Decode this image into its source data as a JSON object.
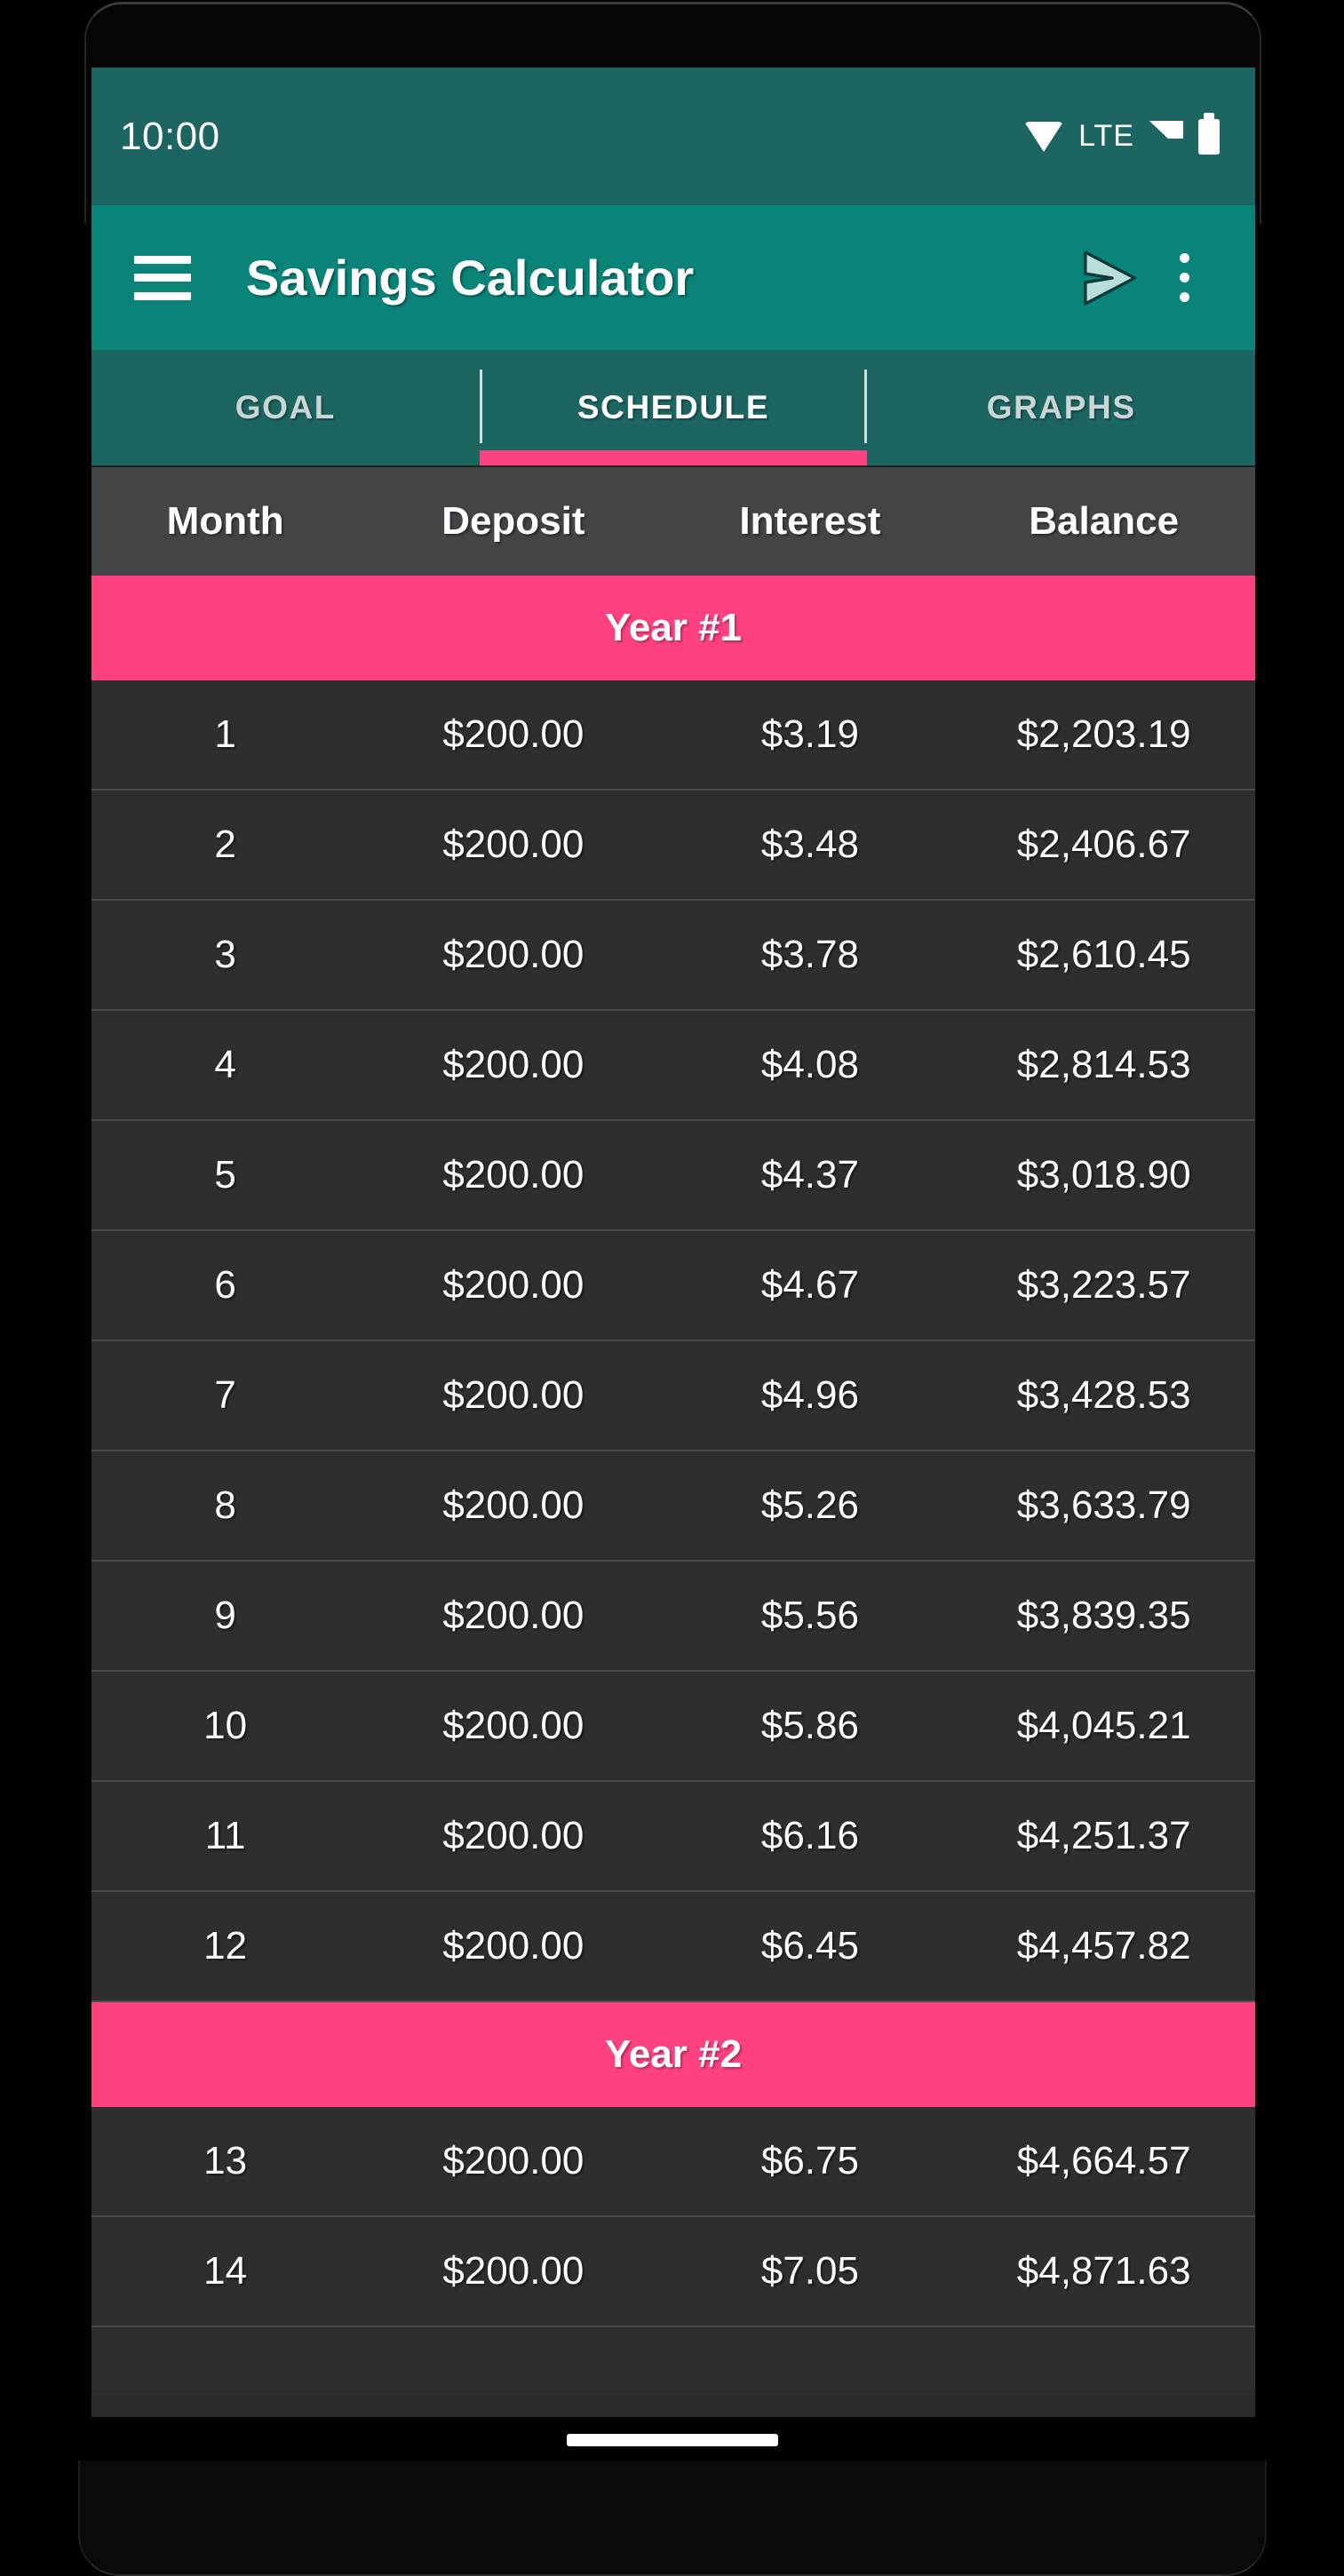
{
  "status_bar": {
    "time": "10:00",
    "network_label": "LTE",
    "icons": [
      "wifi-icon",
      "signal-icon",
      "battery-icon"
    ]
  },
  "app_bar": {
    "title": "Savings Calculator",
    "menu_icon": "hamburger-menu-icon",
    "send_icon": "send-icon",
    "overflow_icon": "overflow-menu-icon"
  },
  "tabs": [
    {
      "label": "GOAL",
      "active": false
    },
    {
      "label": "SCHEDULE",
      "active": true
    },
    {
      "label": "GRAPHS",
      "active": false
    }
  ],
  "colors": {
    "status_bar_teal": "#1d6561",
    "app_bar_teal": "#0a8378",
    "tab_bar_teal": "#1d6561",
    "accent_pink": "#ff4081",
    "table_header_gray": "#414548",
    "row_gray": "#2e2e2e",
    "row_divider": "#4c4c4c"
  },
  "table": {
    "columns": [
      "Month",
      "Deposit",
      "Interest",
      "Balance"
    ],
    "sections": [
      {
        "banner": "Year #1",
        "rows": [
          {
            "month": "1",
            "deposit": "$200.00",
            "interest": "$3.19",
            "balance": "$2,203.19"
          },
          {
            "month": "2",
            "deposit": "$200.00",
            "interest": "$3.48",
            "balance": "$2,406.67"
          },
          {
            "month": "3",
            "deposit": "$200.00",
            "interest": "$3.78",
            "balance": "$2,610.45"
          },
          {
            "month": "4",
            "deposit": "$200.00",
            "interest": "$4.08",
            "balance": "$2,814.53"
          },
          {
            "month": "5",
            "deposit": "$200.00",
            "interest": "$4.37",
            "balance": "$3,018.90"
          },
          {
            "month": "6",
            "deposit": "$200.00",
            "interest": "$4.67",
            "balance": "$3,223.57"
          },
          {
            "month": "7",
            "deposit": "$200.00",
            "interest": "$4.96",
            "balance": "$3,428.53"
          },
          {
            "month": "8",
            "deposit": "$200.00",
            "interest": "$5.26",
            "balance": "$3,633.79"
          },
          {
            "month": "9",
            "deposit": "$200.00",
            "interest": "$5.56",
            "balance": "$3,839.35"
          },
          {
            "month": "10",
            "deposit": "$200.00",
            "interest": "$5.86",
            "balance": "$4,045.21"
          },
          {
            "month": "11",
            "deposit": "$200.00",
            "interest": "$6.16",
            "balance": "$4,251.37"
          },
          {
            "month": "12",
            "deposit": "$200.00",
            "interest": "$6.45",
            "balance": "$4,457.82"
          }
        ]
      },
      {
        "banner": "Year #2",
        "rows": [
          {
            "month": "13",
            "deposit": "$200.00",
            "interest": "$6.75",
            "balance": "$4,664.57"
          },
          {
            "month": "14",
            "deposit": "$200.00",
            "interest": "$7.05",
            "balance": "$4,871.63"
          }
        ]
      }
    ]
  },
  "system_nav": {
    "home_indicator": "gesture-home-indicator"
  }
}
